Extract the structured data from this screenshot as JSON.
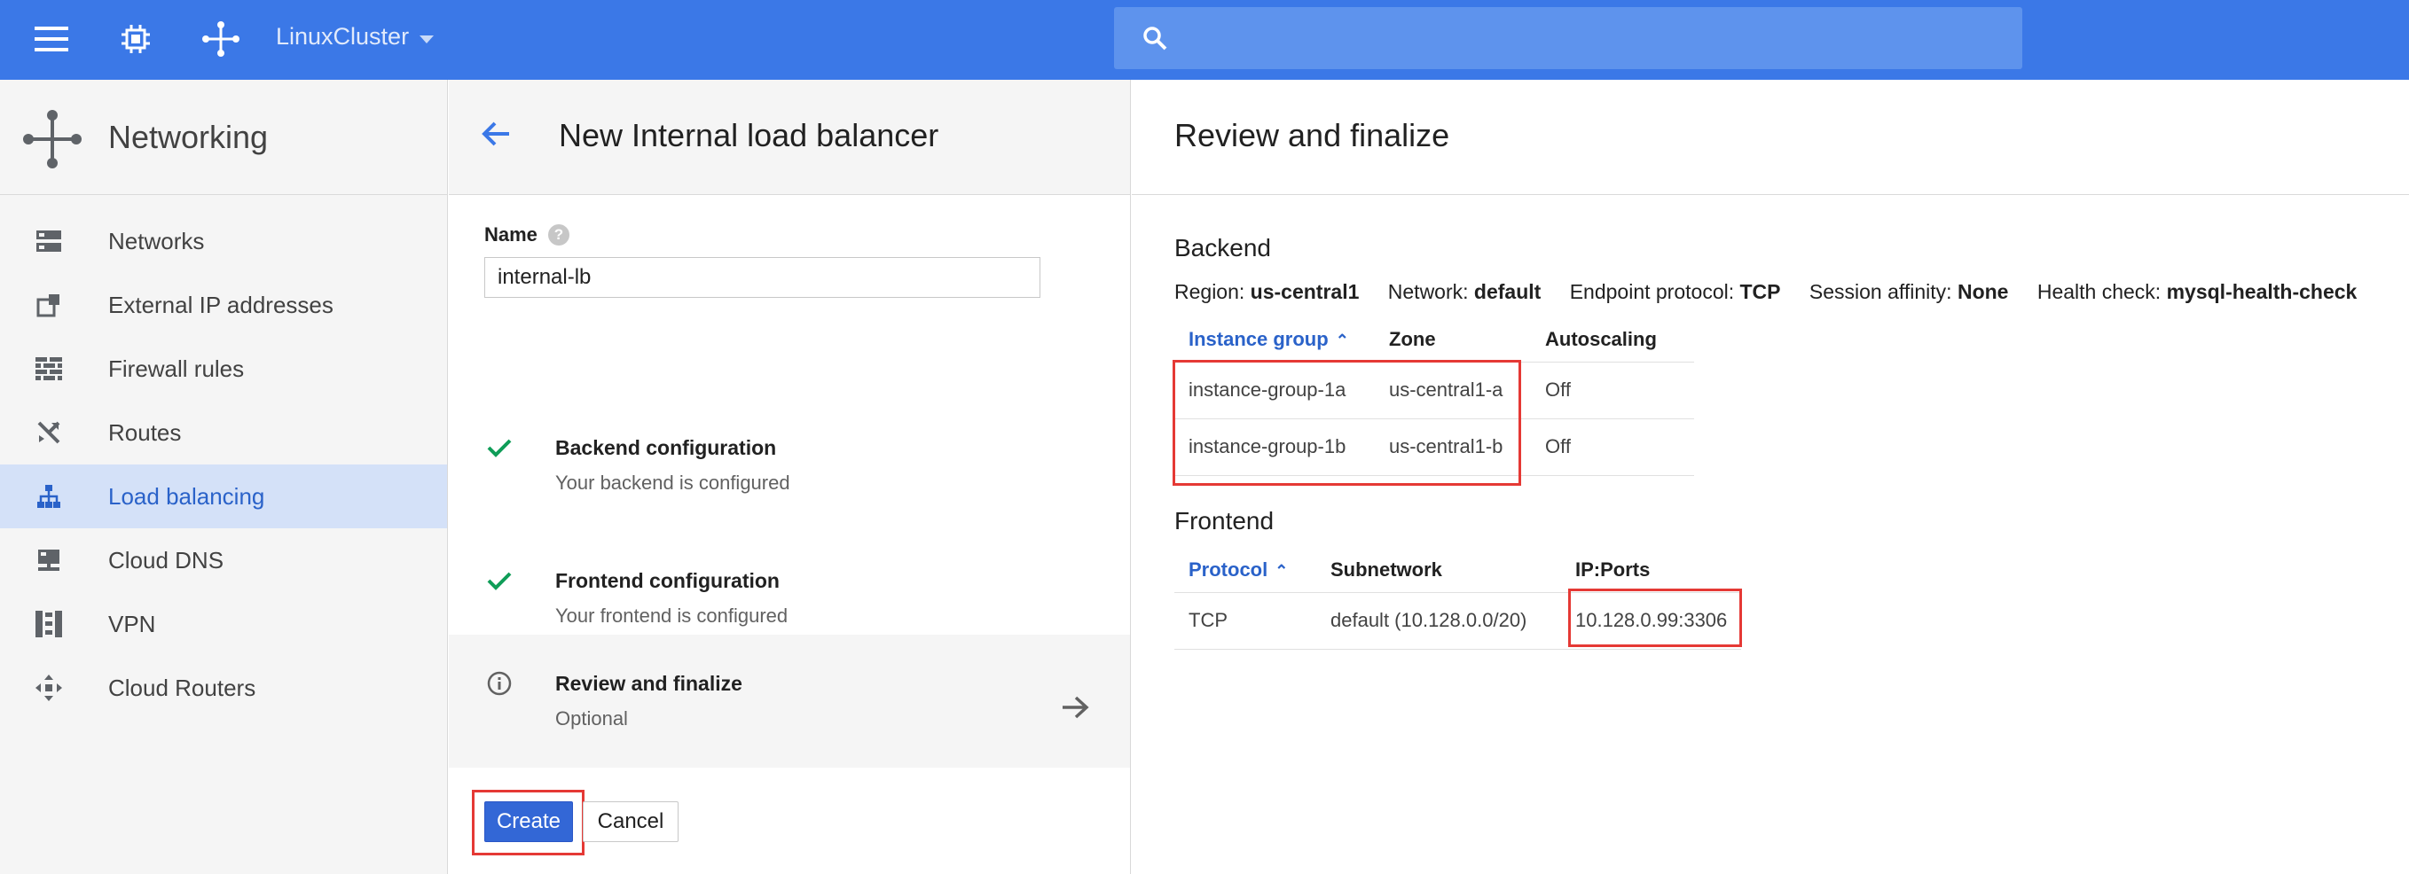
{
  "topbar": {
    "project_name": "LinuxCluster",
    "icons": [
      "menu-icon",
      "chip-icon",
      "network-icon",
      "dropdown-icon",
      "search-icon"
    ],
    "bg_color": "#3b78e7"
  },
  "sidebar": {
    "title": "Networking",
    "items": [
      {
        "label": "Networks",
        "icon": "networks-icon"
      },
      {
        "label": "External IP addresses",
        "icon": "external-ip-icon"
      },
      {
        "label": "Firewall rules",
        "icon": "firewall-icon"
      },
      {
        "label": "Routes",
        "icon": "routes-icon"
      },
      {
        "label": "Load balancing",
        "icon": "load-balancing-icon",
        "active": true
      },
      {
        "label": "Cloud DNS",
        "icon": "cloud-dns-icon"
      },
      {
        "label": "VPN",
        "icon": "vpn-icon"
      },
      {
        "label": "Cloud Routers",
        "icon": "cloud-routers-icon"
      }
    ],
    "active_color": "#d4e1f8"
  },
  "wizard": {
    "title": "New Internal load balancer",
    "name_label": "Name",
    "name_value": "internal-lb",
    "steps": [
      {
        "title": "Backend configuration",
        "subtitle": "Your backend is configured",
        "status": "done"
      },
      {
        "title": "Frontend configuration",
        "subtitle": "Your frontend is configured",
        "status": "done"
      },
      {
        "title": "Review and finalize",
        "subtitle": "Optional",
        "status": "current"
      }
    ],
    "create_label": "Create",
    "cancel_label": "Cancel",
    "check_color": "#0f9d58",
    "primary_color": "#3367d6"
  },
  "review": {
    "title": "Review and finalize",
    "backend": {
      "heading": "Backend",
      "meta": [
        {
          "key": "Region:",
          "value": "us-central1"
        },
        {
          "key": "Network:",
          "value": "default"
        },
        {
          "key": "Endpoint protocol:",
          "value": "TCP"
        },
        {
          "key": "Session affinity:",
          "value": "None"
        },
        {
          "key": "Health check:",
          "value": "mysql-health-check"
        }
      ],
      "columns": [
        "Instance group",
        "Zone",
        "Autoscaling"
      ],
      "rows": [
        [
          "instance-group-1a",
          "us-central1-a",
          "Off"
        ],
        [
          "instance-group-1b",
          "us-central1-b",
          "Off"
        ]
      ]
    },
    "frontend": {
      "heading": "Frontend",
      "columns": [
        "Protocol",
        "Subnetwork",
        "IP:Ports"
      ],
      "rows": [
        [
          "TCP",
          "default (10.128.0.0/20)",
          "10.128.0.99:3306"
        ]
      ]
    },
    "highlight_color": "#e53935"
  }
}
